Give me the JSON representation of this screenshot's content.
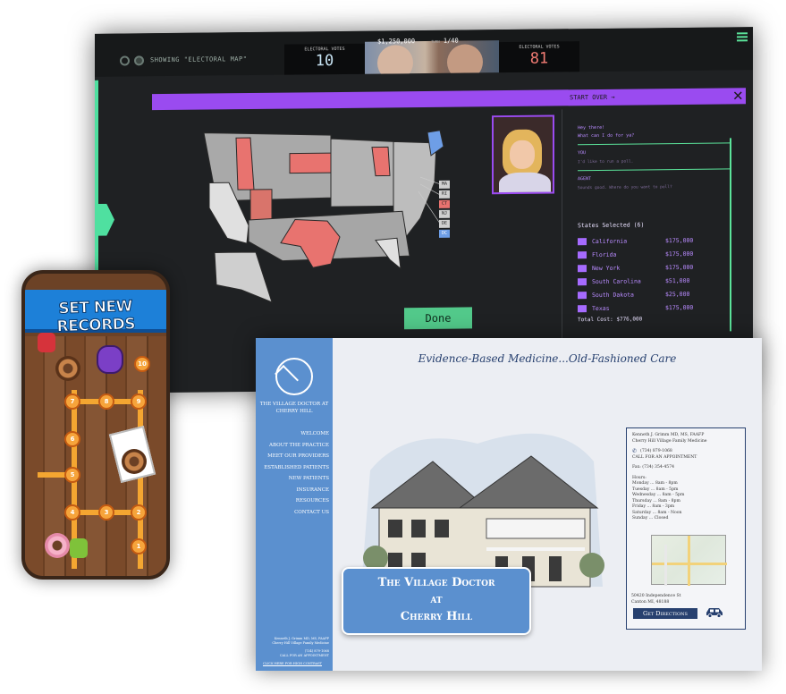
{
  "election": {
    "showing": "SHOWING \"ELECTORAL MAP\"",
    "left_votes_label": "ELECTORAL VOTES",
    "left_votes": "10",
    "right_votes_label": "ELECTORAL VOTES",
    "right_votes": "81",
    "money": "$1,250,000",
    "turn_prefix": "TURN",
    "turn": "1/40",
    "start_over": "START OVER →",
    "close": "✕",
    "done": "Done",
    "legend": [
      "MA",
      "RI",
      "CT",
      "NJ",
      "DE",
      "DC"
    ],
    "chat": {
      "greeting1": "Hey there!",
      "greeting2": "What can I do for ya?",
      "you_label": "YOU",
      "you_text": "I'd like to run a poll.",
      "agent_label": "AGENT",
      "agent_text": "Sounds good. Where do you want to poll?"
    },
    "states_header": "States Selected (6)",
    "states": [
      {
        "name": "California",
        "cost": "$175,000"
      },
      {
        "name": "Florida",
        "cost": "$175,000"
      },
      {
        "name": "New York",
        "cost": "$175,000"
      },
      {
        "name": "South Carolina",
        "cost": "$51,000"
      },
      {
        "name": "South Dakota",
        "cost": "$25,000"
      },
      {
        "name": "Texas",
        "cost": "$175,000"
      }
    ],
    "total": "Total Cost: $776,000",
    "colors": {
      "accent": "#9a4bf0",
      "green": "#52c98a",
      "red": "#e8736f",
      "blue": "#6e9ee6"
    }
  },
  "mobile": {
    "banner": "SET NEW RECORDS",
    "nodes": [
      "7",
      "8",
      "9",
      "6",
      "5",
      "4",
      "3",
      "2",
      "1",
      "10"
    ]
  },
  "doctor": {
    "brand": "THE VILLAGE DOCTOR AT CHERRY HILL",
    "nav": [
      "WELCOME",
      "ABOUT THE PRACTICE",
      "MEET OUR PROVIDERS",
      "ESTABLISHED PATIENTS",
      "NEW PATIENTS",
      "INSURANCE",
      "RESOURCES",
      "CONTACT US"
    ],
    "sidebar_footer_1": "Kenneth J. Grimm MD, MS, FAAFP",
    "sidebar_footer_2": "Cherry Hill Village Family Medicine",
    "sidebar_footer_3": "(734) 879-1068",
    "sidebar_footer_4": "CALL FOR AN APPOINTMENT",
    "sidebar_link": "CLICK HERE FOR HIGH CONTRAST",
    "headline": "Evidence-Based Medicine...Old-Fashioned Care",
    "title_line1": "The Village Doctor",
    "title_line2": "at",
    "title_line3": "Cherry Hill",
    "info": {
      "doctor": "Kenneth J. Grimm MD, MS, FAAFP",
      "practice": "Cherry Hill Village Family Medicine",
      "phone": "(734) 879-1068",
      "call": "CALL FOR AN APPOINTMENT",
      "fax": "Fax: (734) 354-4574",
      "hours_label": "Hours:",
      "hours": [
        "Monday ... 8am - 8pm",
        "Tuesday ... 8am - 5pm",
        "Wednesday ... 8am - 5pm",
        "Thursday ... 8am - 8pm",
        "Friday ... 8am - 3pm",
        "Saturday ... 8am - Noon",
        "Sunday ... Closed"
      ],
      "address1": "50420 Independence St",
      "address2": "Canton MI, 48188",
      "directions": "Get Directions"
    },
    "colors": {
      "sidebar": "#5b90cf",
      "navy": "#27406f"
    }
  }
}
